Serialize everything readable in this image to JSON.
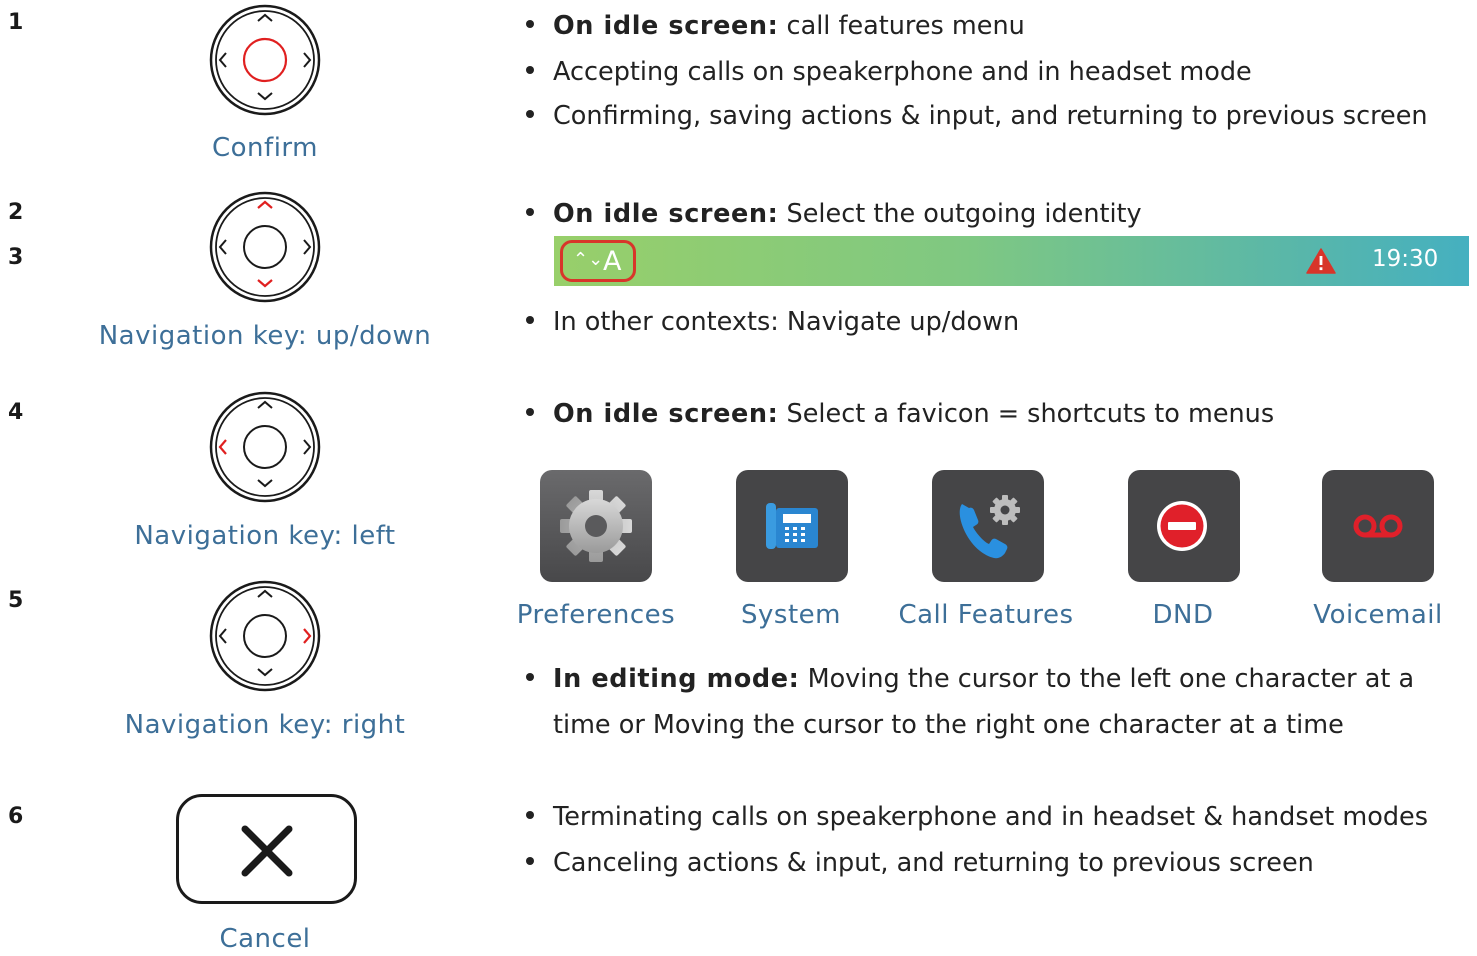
{
  "rows": [
    {
      "number": "1",
      "caption": "Confirm",
      "highlight": "center"
    },
    {
      "numbers": [
        "2",
        "3"
      ],
      "caption": "Navigation key: up/down",
      "highlight": "up-down"
    },
    {
      "number": "4",
      "caption": "Navigation key: left",
      "highlight": "left"
    },
    {
      "number": "5",
      "caption": "Navigation key: right",
      "highlight": "right"
    },
    {
      "number": "6",
      "caption": "Cancel",
      "highlight": "none"
    }
  ],
  "descriptions": {
    "confirm": [
      {
        "bold": "On idle screen:",
        "text": " call features menu"
      },
      {
        "text": "Accepting calls on speakerphone and in headset mode"
      },
      {
        "text": "Confirming, saving actions & input, and returning to previous screen"
      }
    ],
    "updown": [
      {
        "bold": "On idle screen:",
        "text": " Select the outgoing identity"
      },
      {
        "text": "In other contexts: Navigate up/down"
      }
    ],
    "left": [
      {
        "bold": "On idle screen:",
        "text": " Select a favicon = shortcuts to menus"
      }
    ],
    "right": {
      "bold": "In editing mode:",
      "text": " Moving the cursor to the left one character at a",
      "continuation": "time or Moving the cursor to the right one character at a time"
    },
    "cancel": [
      {
        "text": "Terminating calls on speakerphone and in headset & handset modes"
      },
      {
        "text": "Canceling actions & input, and returning to previous screen"
      }
    ]
  },
  "statusbar": {
    "identity": "A",
    "chevron": "⌃⌄",
    "time": "19:30",
    "warning_icon": "warning-triangle-icon",
    "highlight_color": "#d8352a"
  },
  "favicons": [
    {
      "label": "Preferences",
      "icon": "gear-icon"
    },
    {
      "label": "System",
      "icon": "desk-phone-icon"
    },
    {
      "label": "Call Features",
      "icon": "call-features-icon"
    },
    {
      "label": "DND",
      "icon": "do-not-disturb-icon"
    },
    {
      "label": "Voicemail",
      "icon": "voicemail-icon"
    }
  ],
  "colors": {
    "caption": "#3d6f98",
    "highlight": "#e02020",
    "tile": "#4a4a4a"
  }
}
